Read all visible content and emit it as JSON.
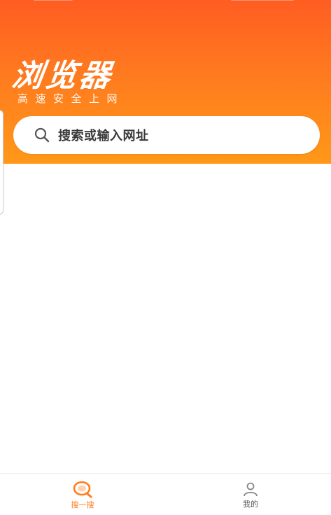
{
  "header": {
    "title": "浏览器",
    "subtitle": "高速安全上网",
    "gradient_top": "#ff5d22",
    "gradient_bottom": "#ff9818"
  },
  "search": {
    "placeholder": "搜索或输入网址",
    "icon": "search-icon"
  },
  "bottom_nav": {
    "items": [
      {
        "label": "搜一搜",
        "icon": "search-magnifier-icon",
        "active": true,
        "color": "#ff7d1e"
      },
      {
        "label": "我的",
        "icon": "profile-icon",
        "active": false,
        "color": "#555555"
      }
    ]
  }
}
